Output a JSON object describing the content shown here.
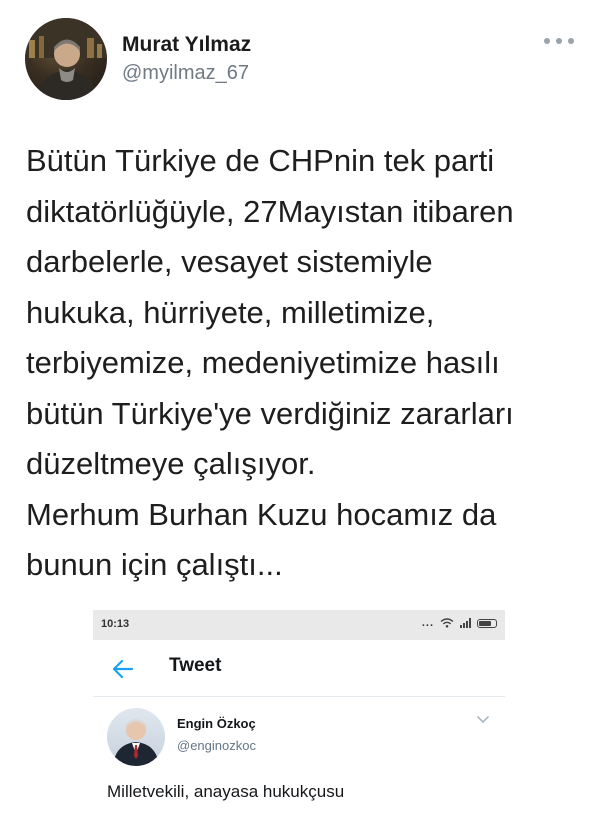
{
  "tweet": {
    "author_name": "Murat Yılmaz",
    "author_handle": "@myilmaz_67",
    "more_icon": "more-horizontal-icon",
    "text_lines": [
      "Bütün Türkiye de CHPnin tek parti",
      "diktatörlüğüyle, 27Mayıstan itibaren",
      "darbelerle, vesayet sistemiyle",
      "hukuka, hürriyete, milletimize,",
      "terbiyemize, medeniyetimize hasılı",
      "bütün Türkiye'ye verdiğiniz zararları",
      "düzeltmeye çalışıyor.",
      "Merhum Burhan Kuzu hocamız da",
      "bunun için çalıştı..."
    ]
  },
  "embedded_screenshot": {
    "status_time": "10:13",
    "status_dots": "...",
    "nav_title": "Tweet",
    "quoted_name": "Engin Özkoç",
    "quoted_handle": "@enginozkoc",
    "quoted_text": "Milletvekili, anayasa hukukçusu"
  },
  "colors": {
    "accent": "#1da1f2",
    "handle_gray": "#6f7a85"
  }
}
